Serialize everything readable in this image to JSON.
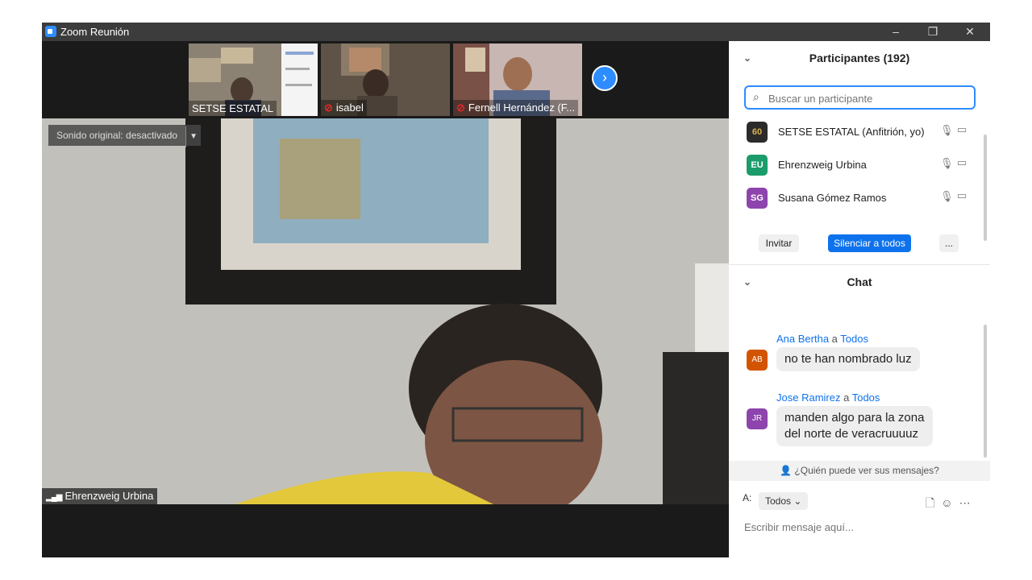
{
  "window": {
    "title": "Zoom Reunión",
    "controls": {
      "minimize": "–",
      "restore": "❐",
      "close": "✕"
    }
  },
  "video": {
    "thumbnails": [
      {
        "name": "SETSE ESTATAL",
        "muted": false
      },
      {
        "name": "isabel",
        "muted": true
      },
      {
        "name": "Fernell Hernández (F...",
        "muted": true
      }
    ],
    "next_icon": "›",
    "sound_original": "Sonido original: desactivado",
    "speaker_name": "Ehrenzweig Urbina"
  },
  "participants": {
    "title": "Participantes (192)",
    "search_placeholder": "Buscar un participante",
    "list": [
      {
        "initials": "60",
        "name": "SETSE ESTATAL (Anfitrión, yo)",
        "color": "#2b2b2b"
      },
      {
        "initials": "EU",
        "name": "Ehrenzweig Urbina",
        "color": "#1a9c6b"
      },
      {
        "initials": "SG",
        "name": "Susana Gómez Ramos",
        "color": "#8e44ad"
      }
    ],
    "buttons": {
      "invite": "Invitar",
      "mute_all": "Silenciar a todos",
      "more": "..."
    }
  },
  "chat": {
    "title": "Chat",
    "messages": [
      {
        "from": "Ana Bertha",
        "a": "a",
        "to": "Todos",
        "text": "no  te han nombrado luz",
        "initials": "AB",
        "color": "#d35400"
      },
      {
        "from": "Jose Ramirez",
        "a": "a",
        "to": "Todos",
        "text": "manden algo para la zona del norte de veracruuuuz",
        "initials": "JR",
        "color": "#8e44ad"
      }
    ],
    "who_can_see": "¿Quién puede ver sus mensajes?",
    "to_label": "A:",
    "to_value": "Todos",
    "input_placeholder": "Escribir mensaje aquí..."
  },
  "colors": {
    "accent": "#2d8cff",
    "button_blue": "#0e72ed"
  }
}
